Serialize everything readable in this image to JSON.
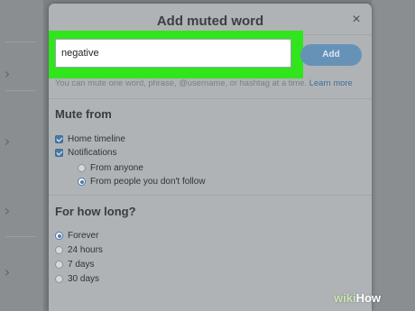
{
  "dialog": {
    "title": "Add muted word",
    "close_symbol": "×",
    "close_icon": "close-icon"
  },
  "input": {
    "value": "negative",
    "placeholder": ""
  },
  "add_button": {
    "label": "Add"
  },
  "hint": {
    "text": "You can mute one word, phrase, @username, or hashtag at a time.",
    "link": "Learn more"
  },
  "mute_from": {
    "title": "Mute from",
    "home_timeline": {
      "label": "Home timeline",
      "checked": true
    },
    "notifications": {
      "label": "Notifications",
      "checked": true
    },
    "from_anyone": {
      "label": "From anyone",
      "selected": false
    },
    "from_not_follow": {
      "label": "From people you don't follow",
      "selected": true
    }
  },
  "duration": {
    "title": "For how long?",
    "options": [
      {
        "label": "Forever",
        "selected": true
      },
      {
        "label": "24 hours",
        "selected": false
      },
      {
        "label": "7 days",
        "selected": false
      },
      {
        "label": "30 days",
        "selected": false
      }
    ]
  },
  "watermark": {
    "wiki": "wiki",
    "how": "How"
  },
  "colors": {
    "highlight": "#30e51c",
    "accent": "#4a7aa8",
    "add_button": "#6792b8"
  }
}
